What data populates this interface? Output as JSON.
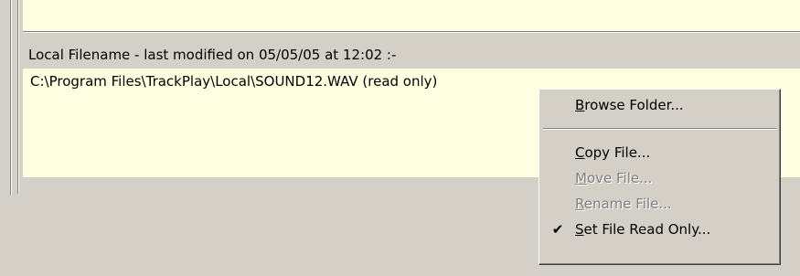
{
  "local_file": {
    "label": "Local Filename - last modified on 05/05/05 at 12:02 :-",
    "path": "C:\\Program Files\\TrackPlay\\Local\\SOUND12.WAV (read only)"
  },
  "context_menu": {
    "items": [
      {
        "mnemonic": "B",
        "rest": "rowse Folder...",
        "enabled": true,
        "checked": false
      },
      {
        "mnemonic": "C",
        "rest": "opy File...",
        "enabled": true,
        "checked": false
      },
      {
        "mnemonic": "M",
        "rest": "ove File...",
        "enabled": false,
        "checked": false
      },
      {
        "mnemonic": "R",
        "rest": "ename File...",
        "enabled": false,
        "checked": false
      },
      {
        "mnemonic": "S",
        "rest": "et File Read Only...",
        "enabled": true,
        "checked": true
      }
    ],
    "check_glyph": "✔"
  },
  "colors": {
    "face": "#d4d0c8",
    "info_background": "#ffffe1",
    "disabled_text": "#808080"
  },
  "icons": {
    "check": "check-icon"
  }
}
